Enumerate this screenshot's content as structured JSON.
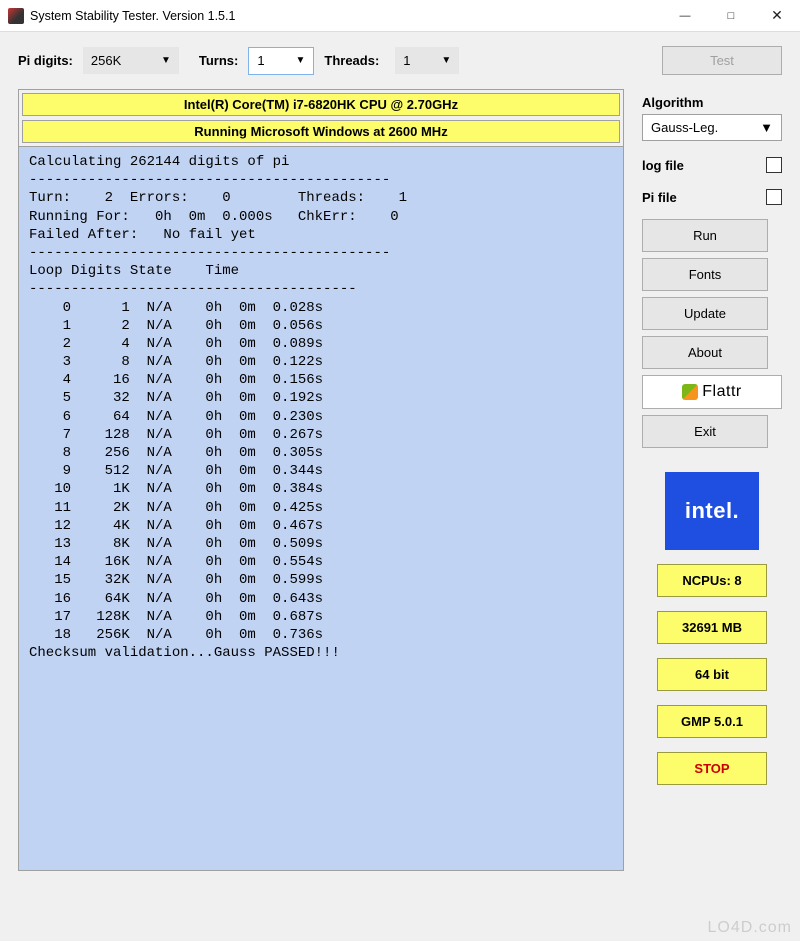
{
  "title": "System Stability Tester. Version 1.5.1",
  "toolbar": {
    "pi_digits_label": "Pi digits:",
    "pi_digits_value": "256K",
    "turns_label": "Turns:",
    "turns_value": "1",
    "threads_label": "Threads:",
    "threads_value": "1",
    "test_label": "Test"
  },
  "banners": {
    "cpu": "Intel(R) Core(TM) i7-6820HK CPU @ 2.70GHz",
    "os": "Running Microsoft Windows at 2600 MHz"
  },
  "console": {
    "header1": "Calculating 262144 digits of pi",
    "sep": "-------------------------------------------",
    "turn_line": "Turn:    2  Errors:    0        Threads:    1",
    "running_line": "Running For:   0h  0m  0.000s   ChkErr:    0",
    "failed_line": "Failed After:   No fail yet",
    "table_header": "Loop Digits State    Time",
    "table_sep": "---------------------------------------",
    "rows": [
      "    0      1  N/A    0h  0m  0.028s",
      "    1      2  N/A    0h  0m  0.056s",
      "    2      4  N/A    0h  0m  0.089s",
      "    3      8  N/A    0h  0m  0.122s",
      "    4     16  N/A    0h  0m  0.156s",
      "    5     32  N/A    0h  0m  0.192s",
      "    6     64  N/A    0h  0m  0.230s",
      "    7    128  N/A    0h  0m  0.267s",
      "    8    256  N/A    0h  0m  0.305s",
      "    9    512  N/A    0h  0m  0.344s",
      "   10     1K  N/A    0h  0m  0.384s",
      "   11     2K  N/A    0h  0m  0.425s",
      "   12     4K  N/A    0h  0m  0.467s",
      "   13     8K  N/A    0h  0m  0.509s",
      "   14    16K  N/A    0h  0m  0.554s",
      "   15    32K  N/A    0h  0m  0.599s",
      "   16    64K  N/A    0h  0m  0.643s",
      "   17   128K  N/A    0h  0m  0.687s",
      "   18   256K  N/A    0h  0m  0.736s"
    ],
    "footer": "Checksum validation...Gauss PASSED!!!"
  },
  "side": {
    "algorithm_label": "Algorithm",
    "algorithm_value": "Gauss-Leg.",
    "logfile_label": "log file",
    "pifile_label": "Pi file",
    "buttons": {
      "run": "Run",
      "fonts": "Fonts",
      "update": "Update",
      "about": "About",
      "flattr": "Flattr",
      "exit": "Exit"
    },
    "intel": "intel.",
    "ncpus": "NCPUs: 8",
    "mem": "32691 MB",
    "arch": "64 bit",
    "gmp": "GMP 5.0.1",
    "stop": "STOP"
  },
  "watermark": "LO4D.com"
}
